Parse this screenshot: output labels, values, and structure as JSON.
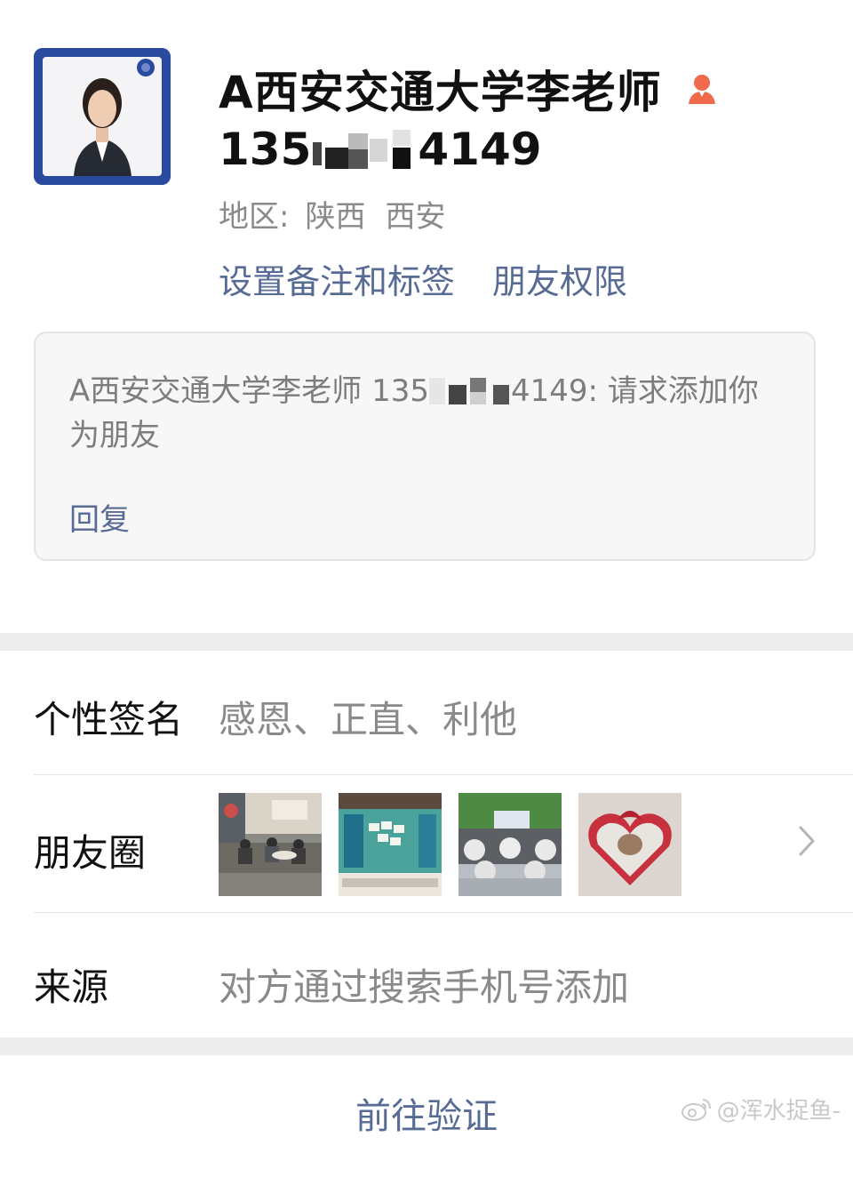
{
  "profile": {
    "name": "A西安交通大学李老师",
    "gender_icon": "female-person-icon",
    "phone_prefix": "135",
    "phone_suffix": "4149",
    "region_label": "地区:",
    "region_province": "陕西",
    "region_city": "西安",
    "set_remark_label": "设置备注和标签",
    "friend_permission_label": "朋友权限"
  },
  "request": {
    "message_prefix": "A西安交通大学李老师 135",
    "message_suffix": "4149: 请求添加你为朋友",
    "reply_label": "回复"
  },
  "info": {
    "signature_label": "个性签名",
    "signature_value": "感恩、正直、利他",
    "moments_label": "朋友圈",
    "moments_photos": [
      "moments-photo-classroom",
      "moments-photo-mahjong",
      "moments-photo-banquet-hall",
      "moments-photo-heart-gift-box"
    ],
    "source_label": "来源",
    "source_value": "对方通过搜索手机号添加"
  },
  "footer": {
    "verify_label": "前往验证",
    "watermark": "@浑水捉鱼-"
  },
  "colors": {
    "link": "#576b95",
    "secondary_text": "#8a8a8a",
    "divider": "#ededed",
    "gender_icon": "#f06a4c"
  }
}
